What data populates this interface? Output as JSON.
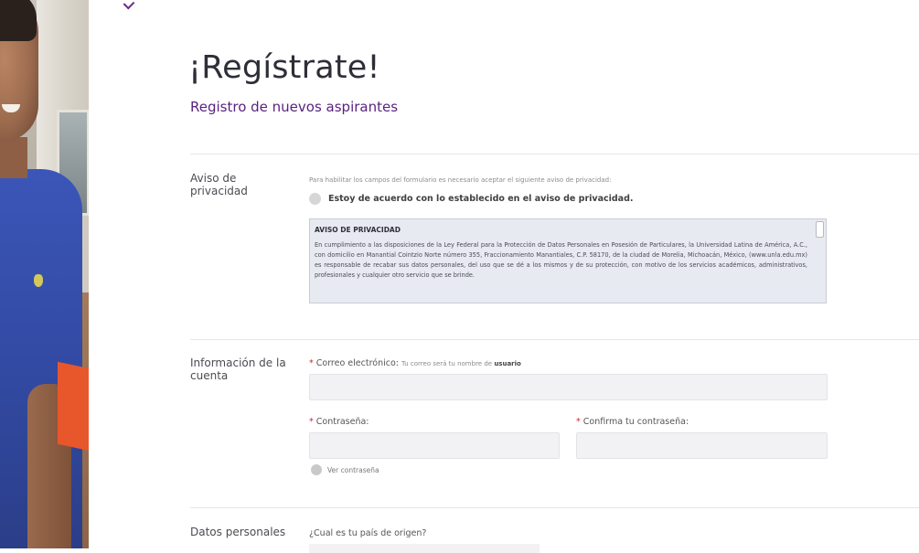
{
  "page": {
    "title": "¡Regístrate!",
    "subtitle": "Registro de nuevos aspirantes"
  },
  "sections": {
    "privacy": {
      "label": "Aviso de privacidad",
      "notice": "Para habilitar los campos del formulario es necesario aceptar el siguiente aviso de privacidad:",
      "agree_label": "Estoy de acuerdo con lo establecido en el aviso de privacidad.",
      "box_title": "AVISO DE PRIVACIDAD",
      "box_text": "En cumplimiento a las disposiciones de la Ley Federal para la Protección de Datos Personales en Posesión de Particulares, la Universidad Latina de América, A.C., con domicilio en Manantial Cointzio Norte número 355, Fraccionamiento Manantiales, C.P. 58170, de la ciudad de Morelia, Michoacán, México, (www.unla.edu.mx) es responsable de recabar sus datos personales, del uso que se dé a los mismos y de su protección, con motivo de los servicios académicos, administrativos, profesionales y cualquier otro servicio que se brinde."
    },
    "account": {
      "label": "Información de la cuenta",
      "email_label": "Correo electrónico:",
      "email_hint": "Tu correo será tu nombre de",
      "email_hint_bold": "usuario",
      "password_label": "Contraseña:",
      "confirm_label": "Confirma tu contraseña:",
      "show_password_label": "Ver contraseña"
    },
    "personal": {
      "label": "Datos personales",
      "country_question": "¿Cual es tu país de origen?"
    }
  },
  "colors": {
    "accent_purple": "#5a2280",
    "required_red": "#d0262f"
  },
  "icons": {
    "required": "asterisk"
  }
}
